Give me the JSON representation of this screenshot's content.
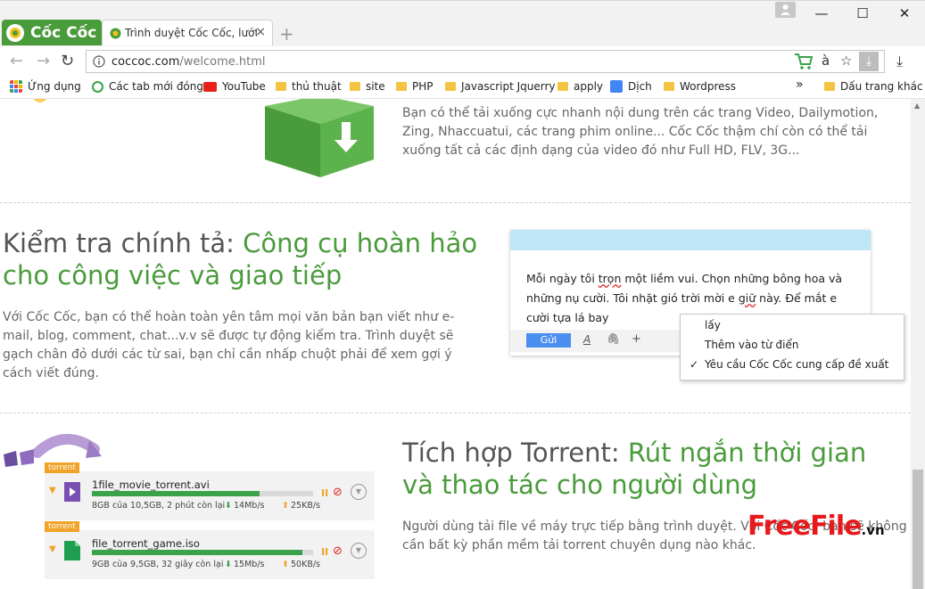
{
  "window": {
    "brand_name": "Cốc Cốc",
    "tab_title": "Trình duyệt Cốc Cốc, lướt web",
    "tab_close": "×",
    "new_tab": "+",
    "controls": {
      "minimize": "—",
      "maximize": "☐",
      "close": "✕"
    }
  },
  "address_bar": {
    "url_host": "coccoc.com",
    "url_path": "/welcome.html",
    "translate_glyph": "à",
    "star_glyph": "☆",
    "download_glyph": "⤓"
  },
  "bookmarks": {
    "items": [
      {
        "label": "Ứng dụng",
        "icon": "apps-grid-icon"
      },
      {
        "label": "Các tab mới đóng",
        "icon": "history-icon"
      },
      {
        "label": "YouTube",
        "icon": "youtube-icon"
      },
      {
        "label": "thủ thuật",
        "icon": "folder-icon"
      },
      {
        "label": "site",
        "icon": "folder-icon"
      },
      {
        "label": "PHP",
        "icon": "folder-icon"
      },
      {
        "label": "Javascript Jquerry",
        "icon": "folder-icon"
      },
      {
        "label": "apply",
        "icon": "folder-icon"
      },
      {
        "label": "Dịch",
        "icon": "google-translate-icon"
      },
      {
        "label": "Wordpress",
        "icon": "folder-icon"
      }
    ],
    "overflow": "»",
    "other": "Dấu trang khác"
  },
  "download_section": {
    "text": "Bạn có thể tải xuống cực nhanh nội dung trên các trang Video, Dailymotion, Zing, Nhaccuatui, các trang phim online... Cốc Cốc thậm chí còn có thể tải xuống tất cả các định dạng của video đó như Full HD, FLV, 3G..."
  },
  "spell_section": {
    "title_plain": "Kiểm tra chính tả: ",
    "title_green": "Công cụ hoàn hảo cho công việc và giao tiếp",
    "text": "Với Cốc Cốc, bạn có thể hoàn toàn yên tâm mọi văn bản bạn viết như e-mail, blog, comment, chat...v.v sẽ được tự động kiểm tra. Trình duyệt sẽ gạch chân đỏ dưới các từ sai, bạn chỉ cần nhấp chuột phải để xem gợi ý cách viết đúng.",
    "demo_text_1": "Mỗi ngày tôi ",
    "demo_wrong_1": "trọn",
    "demo_text_2": " một liềm vui. Chọn những bông hoa và những nụ cười. Tôi nhặt gió trời mời e ",
    "demo_wrong_2": "giữ",
    "demo_text_3": " này. Để mắt e cười tựa lá bay",
    "send_label": "Gửi",
    "toolbar_format": "A",
    "toolbar_attach": "🖇",
    "toolbar_more": "+",
    "context_menu": {
      "suggestion": "lấy",
      "add_dictionary": "Thêm vào từ điển",
      "ask_suggest": "Yêu cầu Cốc Cốc cung cấp đề xuất",
      "check": "✓"
    }
  },
  "torrent_section": {
    "title_plain": "Tích hợp Torrent: ",
    "title_green": "Rút ngắn thời gian và thao tác cho người dùng",
    "text": "Người dùng tải file về máy trực tiếp bằng trình duyệt. Với Cốc Cốc, bạn sẽ không cần bất kỳ phần mềm tải torrent chuyên dụng nào khác.",
    "items": [
      {
        "tag": "torrent",
        "file": "1file_movie_torrent.avi",
        "progress_label": "8GB của 10,5GB, 2 phút còn lại",
        "down": "14Mb/s",
        "up": "25KB/s",
        "progress": 0.76
      },
      {
        "tag": "torrent",
        "file": "file_torrent_game.iso",
        "progress_label": "9GB của 9,5GB, 32 giây còn lại",
        "down": "15Mb/s",
        "up": "50KB/s",
        "progress": 0.95
      }
    ]
  },
  "watermark": {
    "text": "FreeFile",
    "suffix": ".vn"
  },
  "colors": {
    "brand_green": "#4a9b3c",
    "accent_blue": "#4a8ef0",
    "torrent_orange": "#f0a326",
    "error_red": "#e02020"
  }
}
